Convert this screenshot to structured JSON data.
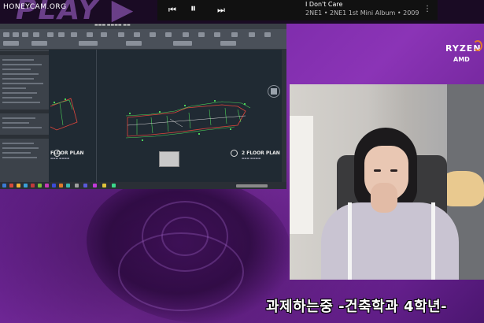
{
  "watermark": "HONEYCAM.ORG",
  "music": {
    "title": "I Don't Care",
    "subtitle": "2NE1 • 2NE1 1st Mini Album • 2009",
    "prev_icon": "skip-previous-icon",
    "pause_icon": "pause-icon",
    "next_icon": "skip-next-icon",
    "more_icon": "more-vert-icon"
  },
  "sponsor": {
    "ryzen": "RYZEN",
    "amd": "AMD"
  },
  "cad": {
    "plan_left": "FLOOR PLAN",
    "plan_right": "2 FLOOR PLAN"
  },
  "subtitle": "과제하는중 -건축학과 4학년-",
  "colors": {
    "accent_purple": "#8b34b6",
    "ryzen_orange": "#e27a2a",
    "drawing_green": "#4cd25a",
    "drawing_red": "#e0463c"
  }
}
